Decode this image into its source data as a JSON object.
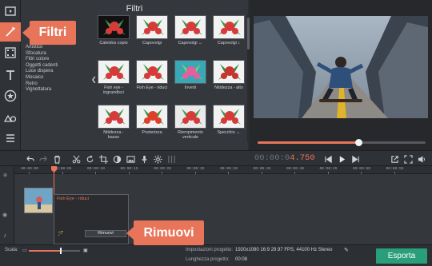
{
  "colors": {
    "accent": "#e8745a",
    "export": "#2a9d79",
    "background": "#2b2e33"
  },
  "sidebar": {
    "tools": [
      {
        "name": "import-media",
        "icon": "film-import-icon"
      },
      {
        "name": "filters",
        "icon": "magic-wand-icon",
        "active": true
      },
      {
        "name": "transitions",
        "icon": "film-strip-icon"
      },
      {
        "name": "titles",
        "icon": "text-t-icon"
      },
      {
        "name": "stickers",
        "icon": "star-badge-icon"
      },
      {
        "name": "more-tools",
        "icon": "shapes-icon"
      },
      {
        "name": "menu",
        "icon": "hamburger-icon"
      }
    ]
  },
  "filters_panel": {
    "title": "Filtri",
    "categories": [
      "Artistico",
      "Sfocatura",
      "Filtri colore",
      "Oggetti cadenti",
      "Luce dispera",
      "Mosaico",
      "Retro",
      "Vignettatura"
    ],
    "filters": [
      {
        "label": "Caleidos copio"
      },
      {
        "label": "Capovolgi"
      },
      {
        "label": "Capovolgi ↔"
      },
      {
        "label": "Capovolgi ↕"
      },
      {
        "label": "Fish eye - ingrandisci"
      },
      {
        "label": "Fish Eye - riduci"
      },
      {
        "label": "Inverti"
      },
      {
        "label": "Nitidezza - alto"
      },
      {
        "label": "Nitidezza - basso"
      },
      {
        "label": "Posterizza"
      },
      {
        "label": "Riempimento verticale"
      },
      {
        "label": "Specchio ↔"
      }
    ]
  },
  "preview": {
    "progress": 0.6
  },
  "edit_toolbar": {
    "timecode_prefix": "00:00:0",
    "timecode_value": "4.750"
  },
  "timeline": {
    "ruler_labels": [
      "00:00:00",
      "00:00:05",
      "00:00:10",
      "00:00:15",
      "00:00:20",
      "00:00:25",
      "00:00:30",
      "00:00:35",
      "00:00:40",
      "00:00:45",
      "00:00:50",
      "00:00:55"
    ],
    "applied_filter": "Fish Eye - riduci",
    "remove_label": "Rimuovi"
  },
  "bottom_bar": {
    "scale_label": "Scala:",
    "scale_level": 0.62,
    "settings_label": "Impostazioni progetto:",
    "settings_value": "1920x1080 16:9 29.97 FPS, 44100 Hz Stereo",
    "length_label": "Lunghezza progetto:",
    "length_value": "00:08",
    "export_label": "Esporta"
  },
  "callouts": {
    "filtri": "Filtri",
    "rimuovi": "Rimuovi"
  }
}
